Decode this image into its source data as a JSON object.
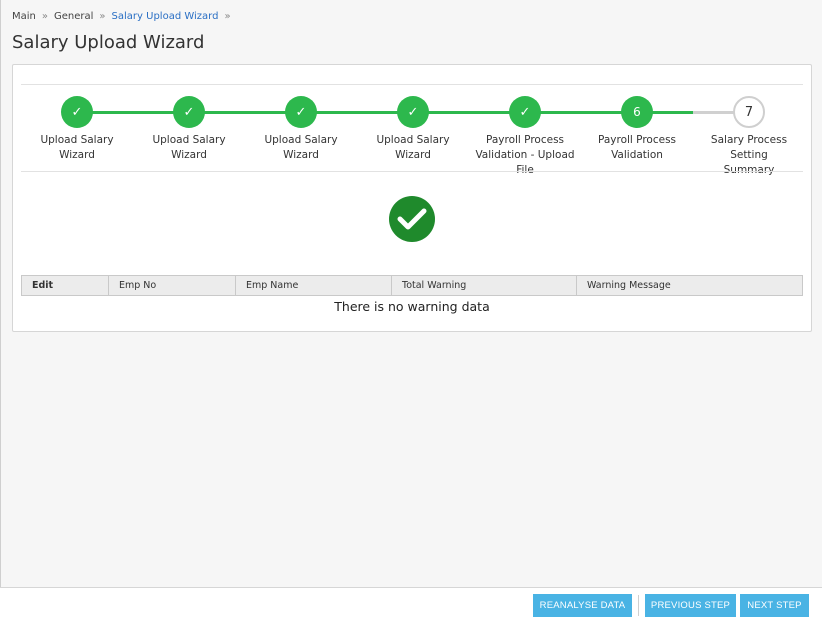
{
  "breadcrumb": {
    "items": [
      "Main",
      "General",
      "Salary Upload Wizard"
    ],
    "separator": "»"
  },
  "page": {
    "title": "Salary Upload Wizard"
  },
  "stepper": {
    "steps": [
      {
        "label": "Upload Salary Wizard",
        "state": "done",
        "marker": "✓"
      },
      {
        "label": "Upload Salary Wizard",
        "state": "done",
        "marker": "✓"
      },
      {
        "label": "Upload Salary Wizard",
        "state": "done",
        "marker": "✓"
      },
      {
        "label": "Upload Salary Wizard",
        "state": "done",
        "marker": "✓"
      },
      {
        "label": "Payroll Process\nValidation - Upload File",
        "state": "done",
        "marker": "✓"
      },
      {
        "label": "Payroll Process\nValidation",
        "state": "current",
        "marker": "6"
      },
      {
        "label": "Salary Process Setting\nSummary",
        "state": "pending",
        "marker": "7"
      }
    ],
    "colors": {
      "done": "#2db84d",
      "pending": "#cfcfcf"
    }
  },
  "result": {
    "icon": "check-circle-icon",
    "color": "#1f8a2c"
  },
  "grid": {
    "columns": [
      "Edit",
      "Emp No",
      "Emp Name",
      "Total Warning",
      "Warning Message"
    ],
    "empty_message": "There is no warning data"
  },
  "footer": {
    "reanalyse_label": "REANALYSE DATA",
    "previous_label": "PREVIOUS STEP",
    "next_label": "NEXT STEP",
    "button_color": "#49b3e4"
  }
}
